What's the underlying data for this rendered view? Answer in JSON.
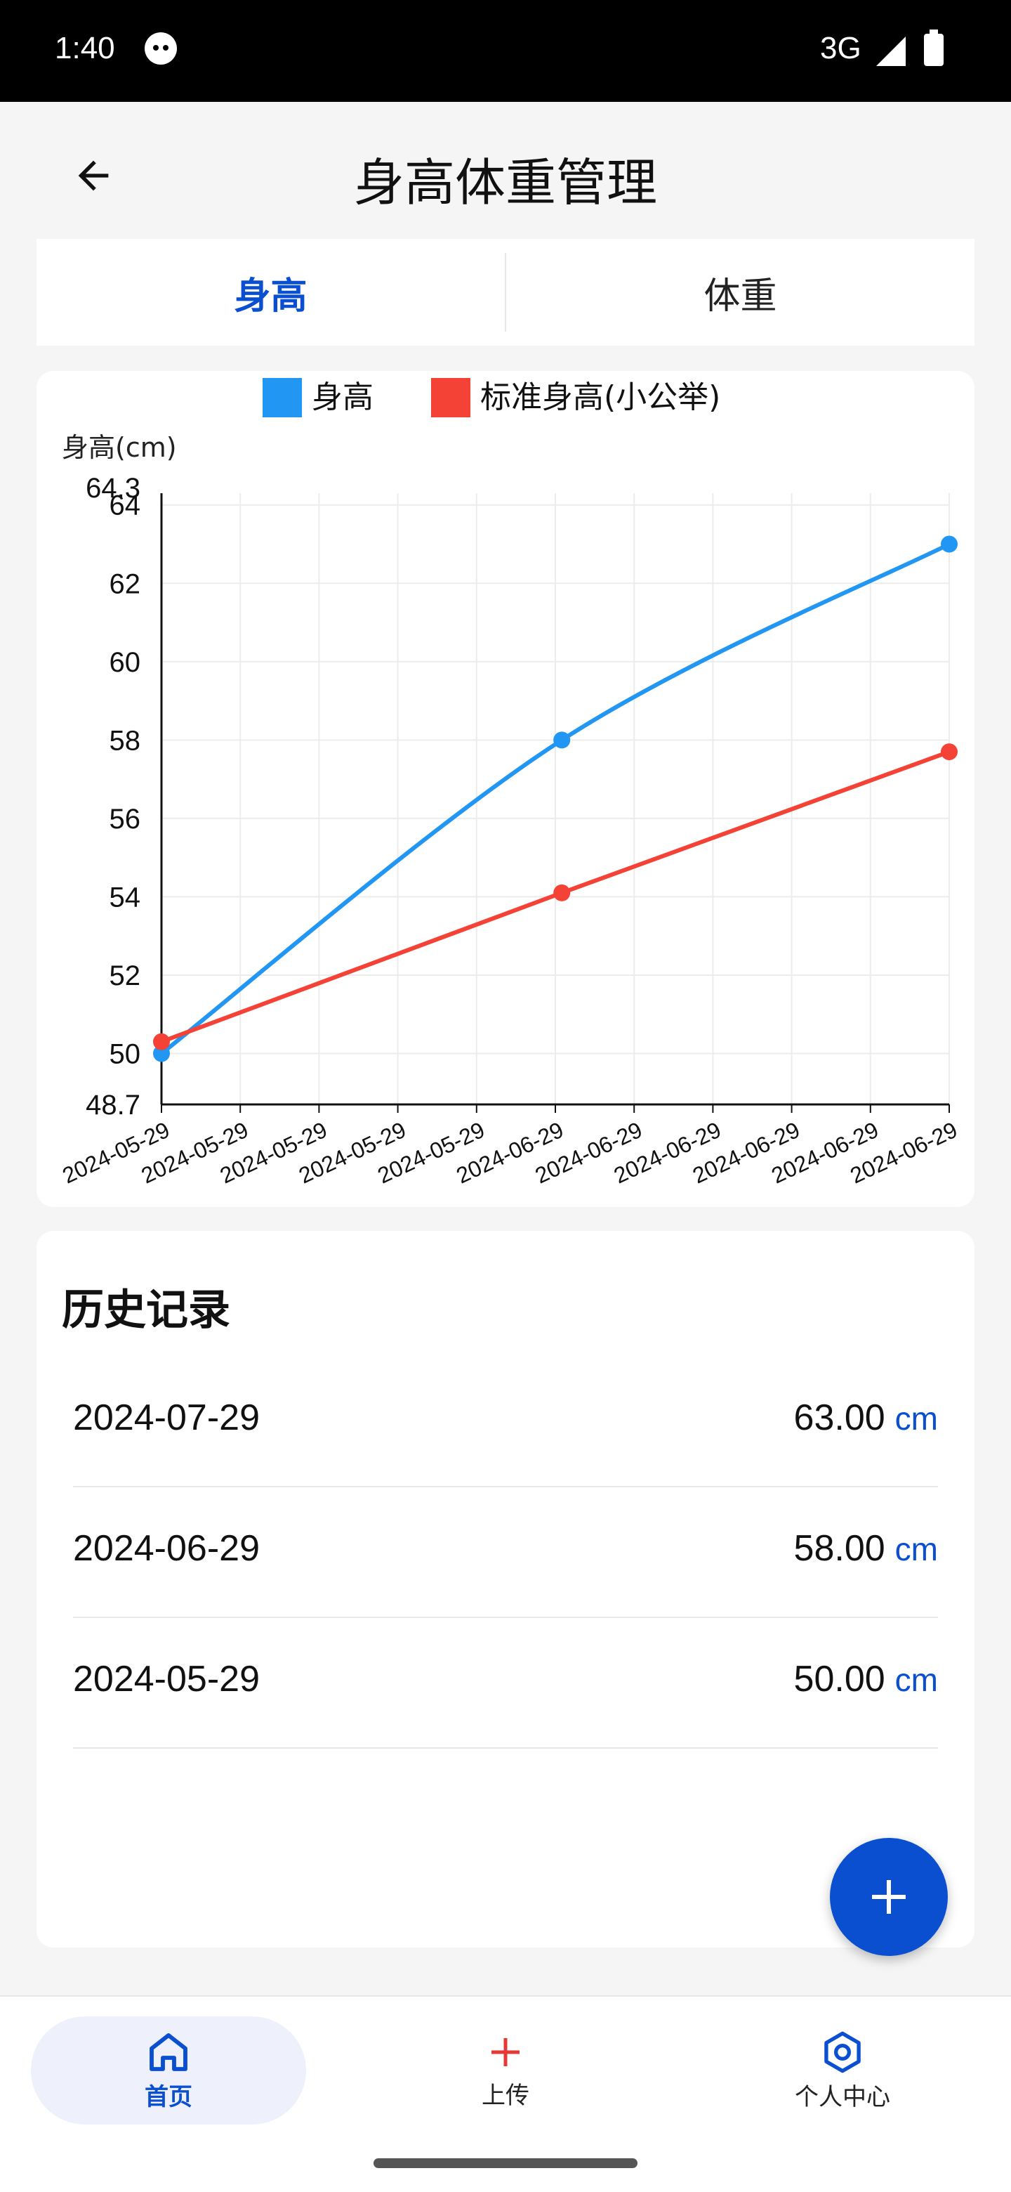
{
  "status_bar": {
    "time": "1:40",
    "network": "3G"
  },
  "app_bar": {
    "title": "身高体重管理"
  },
  "tabs": [
    {
      "label": "身高",
      "active": true
    },
    {
      "label": "体重",
      "active": false
    }
  ],
  "chart_data": {
    "type": "line",
    "ylabel": "身高(cm)",
    "ylim": [
      48.7,
      64.3
    ],
    "y_ticks": [
      50,
      52,
      54,
      56,
      58,
      60,
      62,
      64
    ],
    "y_min_label": "48.7",
    "y_max_label": "64.3",
    "x_tick_labels": [
      "2024-05-29",
      "2024-05-29",
      "2024-05-29",
      "2024-05-29",
      "2024-05-29",
      "2024-06-29",
      "2024-06-29",
      "2024-06-29",
      "2024-06-29",
      "2024-06-29",
      "2024-06-29"
    ],
    "legend_position": "top-center",
    "grid": true,
    "series": [
      {
        "name": "身高",
        "color": "#2196f3",
        "points": [
          {
            "x": "2024-05-29",
            "y": 50.0
          },
          {
            "x": "2024-06-29",
            "y": 58.0
          },
          {
            "x": "2024-07-29",
            "y": 63.0
          }
        ]
      },
      {
        "name": "标准身高(小公举)",
        "color": "#f44336",
        "points": [
          {
            "x": "2024-05-29",
            "y": 50.3
          },
          {
            "x": "2024-06-29",
            "y": 54.1
          },
          {
            "x": "2024-07-29",
            "y": 57.7
          }
        ]
      }
    ]
  },
  "history": {
    "title": "历史记录",
    "records": [
      {
        "date": "2024-07-29",
        "value": "63.00",
        "unit": "cm"
      },
      {
        "date": "2024-06-29",
        "value": "58.00",
        "unit": "cm"
      },
      {
        "date": "2024-05-29",
        "value": "50.00",
        "unit": "cm"
      }
    ]
  },
  "bottom_nav": [
    {
      "label": "首页",
      "icon": "home-icon",
      "active": true
    },
    {
      "label": "上传",
      "icon": "plus-icon",
      "active": false
    },
    {
      "label": "个人中心",
      "icon": "hexagon-settings-icon",
      "active": false
    }
  ],
  "colors": {
    "primary": "#0b4fd1",
    "height_series": "#2196f3",
    "standard_series": "#f44336"
  }
}
